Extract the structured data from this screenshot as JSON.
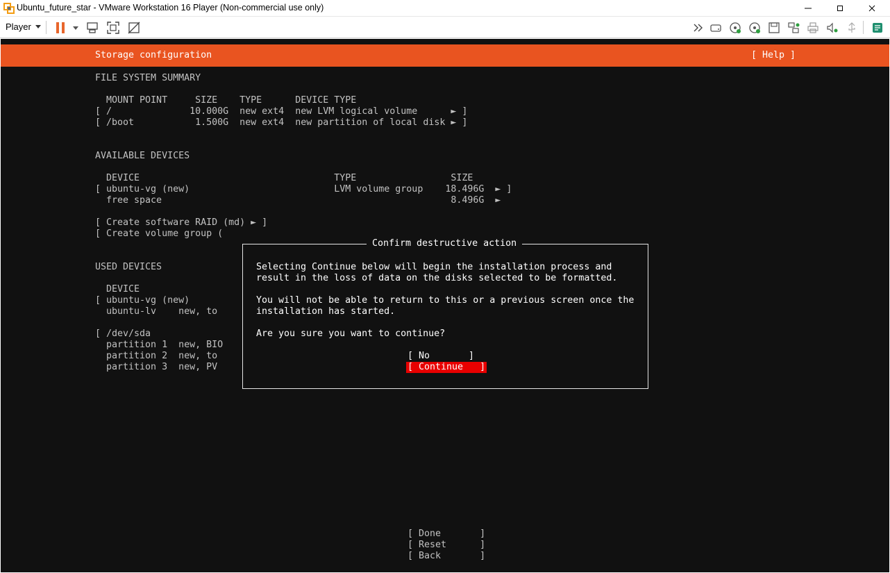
{
  "window": {
    "title": "Ubuntu_future_star - VMware Workstation 16 Player (Non-commercial use only)"
  },
  "toolbar": {
    "player_label": "Player",
    "icons": [
      "pause-icon",
      "send-ctrl-alt-del-icon",
      "fullscreen-icon",
      "unity-icon",
      "more-devices-icon",
      "hard-disk-icon",
      "cd-dvd-icon",
      "cd-dvd-2-icon",
      "floppy-icon",
      "network-icon",
      "printer-icon",
      "sound-icon",
      "message-log-icon"
    ]
  },
  "colors": {
    "ubuntu_orange": "#e95420",
    "terminal_bg": "#111111",
    "focus_red": "#e80000"
  },
  "screen": {
    "header_title": "Storage configuration",
    "help_label": "[ Help ]",
    "fs_summary": {
      "heading": "FILE SYSTEM SUMMARY",
      "columns_line": "  MOUNT POINT     SIZE    TYPE      DEVICE TYPE",
      "rows": [
        "[ /              10.000G  new ext4  new LVM logical volume      ► ]",
        "[ /boot           1.500G  new ext4  new partition of local disk ► ]"
      ]
    },
    "available_devices": {
      "heading": "AVAILABLE DEVICES",
      "columns_line": "  DEVICE                                   TYPE                 SIZE",
      "rows": [
        "[ ubuntu-vg (new)                          LVM volume group    18.496G  ► ]",
        "  free space                                                    8.496G  ►"
      ],
      "actions": [
        "[ Create software RAID (md) ► ]",
        "[ Create volume group ("
      ]
    },
    "used_devices": {
      "heading": "USED DEVICES",
      "columns_line": "  DEVICE",
      "rows": [
        "[ ubuntu-vg (new)",
        "  ubuntu-lv    new, to",
        "",
        "[ /dev/sda",
        "  partition 1  new, BIO",
        "  partition 2  new, to",
        "  partition 3  new, PV"
      ]
    },
    "bottom_buttons": {
      "done": "[ Done       ]",
      "reset": "[ Reset      ]",
      "back": "[ Back       ]"
    }
  },
  "dialog": {
    "title": "Confirm destructive action",
    "lines": [
      "Selecting Continue below will begin the installation process and",
      "result in the loss of data on the disks selected to be formatted.",
      "",
      "You will not be able to return to this or a previous screen once the",
      "installation has started.",
      "",
      "Are you sure you want to continue?"
    ],
    "no_button": "[ No       ]",
    "continue_button": "[ Continue   ]"
  }
}
